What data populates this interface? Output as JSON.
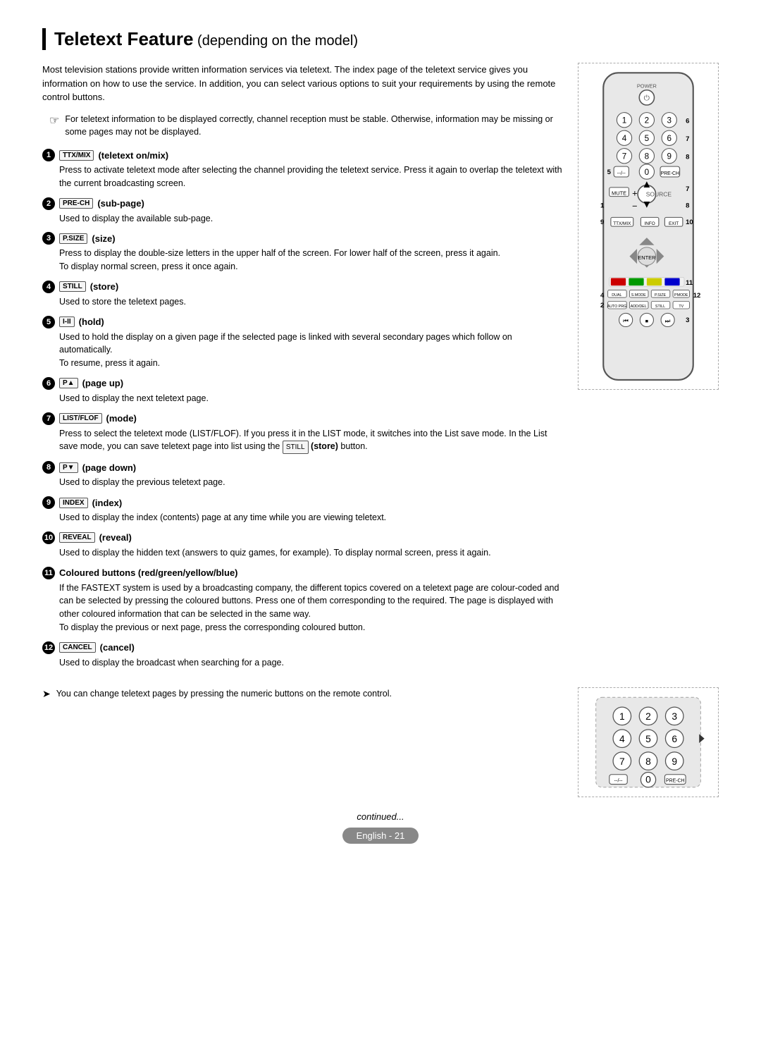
{
  "title": {
    "bold": "Teletext Feature",
    "normal": " (depending on the model)"
  },
  "intro": "Most television stations provide written information services via teletext. The index page of the teletext service gives you information on how to use the service. In addition, you can select various options to suit your requirements by using the remote control buttons.",
  "note": "For teletext information to be displayed correctly, channel reception must be stable. Otherwise, information may be missing or some pages may not be displayed.",
  "features": [
    {
      "num": "1",
      "icon": "TTX/MIX",
      "label": "teletext on/mix",
      "body": "Press to activate teletext mode after selecting the channel providing the teletext service. Press it again to overlap the teletext with the current broadcasting screen."
    },
    {
      "num": "2",
      "icon": "PRE-CH",
      "label": "sub-page",
      "body": "Used to display the available sub-page."
    },
    {
      "num": "3",
      "icon": "P.SIZE",
      "label": "size",
      "body": "Press to display the double-size letters in the upper half of the screen. For lower half of the screen, press it again.\nTo display normal screen, press it once again."
    },
    {
      "num": "4",
      "icon": "STILL",
      "label": "store",
      "body": "Used to store the teletext pages."
    },
    {
      "num": "5",
      "icon": "1-II",
      "label": "hold",
      "body": "Used to hold the display on a given page if the selected page is linked with several secondary pages which follow on automatically.\nTo resume, press it again."
    },
    {
      "num": "6",
      "icon": "P▲",
      "label": "page up",
      "body": "Used to display the next teletext page."
    },
    {
      "num": "7",
      "icon": "LIST/FLOF",
      "label": "mode",
      "body": "Press to select the teletext mode (LIST/FLOF). If you press it in the LIST mode, it switches into the List save mode. In the List save mode, you can save teletext page into list using the  (store) button."
    },
    {
      "num": "8",
      "icon": "P▼",
      "label": "page down",
      "body": "Used to display the previous teletext page."
    },
    {
      "num": "9",
      "icon": "INDEX",
      "label": "index",
      "body": "Used to display the index (contents) page at any time while you are viewing teletext."
    },
    {
      "num": "10",
      "icon": "REVEAL",
      "label": "reveal",
      "body": "Used to display the hidden text (answers to quiz games, for example). To display normal screen, press it again."
    },
    {
      "num": "11",
      "icon": "COLOR",
      "label": "Coloured buttons (red/green/yellow/blue)",
      "body": "If the FASTEXT system is used by a broadcasting company, the different topics covered on a teletext page are colour-coded and can be selected by pressing the coloured buttons. Press one of them corresponding to the required. The page is displayed with other coloured information that can be selected in the same way.\nTo display the previous or next page, press the corresponding coloured button."
    },
    {
      "num": "12",
      "icon": "CANCEL",
      "label": "cancel",
      "body": "Used to display the broadcast when searching for a page."
    }
  ],
  "arrow_note": "You can change teletext pages by pressing the numeric buttons on the remote control.",
  "continued": "continued...",
  "footer": {
    "label": "English",
    "page": "21"
  }
}
